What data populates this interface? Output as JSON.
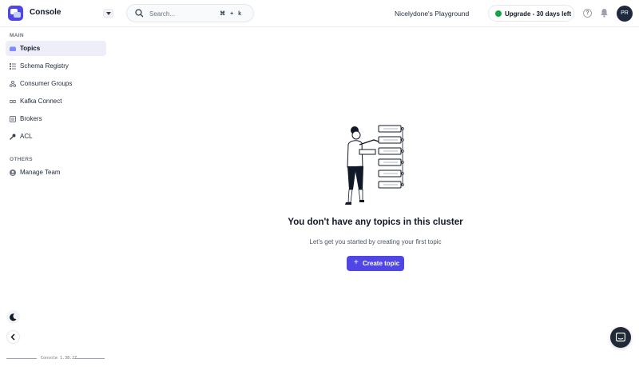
{
  "header": {
    "app_title": "Console",
    "search_placeholder": "Search...",
    "search_shortcut": "⌘ + k",
    "workspace": "Nicelydone's Playground",
    "upgrade_label": "Upgrade - 30 days left",
    "help_glyph": "?",
    "avatar_initials": "PR"
  },
  "sidebar": {
    "main_section": "MAIN",
    "items": [
      {
        "label": "Topics",
        "icon": "topics-icon",
        "active": true
      },
      {
        "label": "Schema Registry",
        "icon": "schema-icon"
      },
      {
        "label": "Consumer Groups",
        "icon": "consumer-groups-icon"
      },
      {
        "label": "Kafka Connect",
        "icon": "connect-icon"
      },
      {
        "label": "Brokers",
        "icon": "brokers-icon"
      },
      {
        "label": "ACL",
        "icon": "key-icon"
      }
    ],
    "others_section": "OTHERS",
    "others_items": [
      {
        "label": "Manage Team",
        "icon": "user-icon"
      }
    ],
    "version": "Console 1.38.27"
  },
  "main": {
    "empty_title": "You don't have any topics in this cluster",
    "empty_subtitle": "Let's get you started by creating your first topic",
    "create_button": "Create topic"
  },
  "colors": {
    "accent": "#4f46e5",
    "upgrade_dot": "#16a34a",
    "active_bg": "#eeeef8"
  }
}
